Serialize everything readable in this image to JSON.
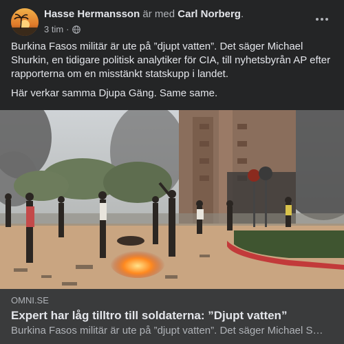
{
  "post": {
    "author": "Hasse Hermansson",
    "with_text": "är med",
    "tagged": "Carl Norberg",
    "tagged_suffix": ".",
    "time": "3 tim",
    "separator": "·",
    "privacy_icon": "globe-icon",
    "more_icon": "more-options-icon",
    "paragraphs": [
      "Burkina Fasos militär är ute på ”djupt vatten”. Det säger Michael Shurkin, en tidigare politisk analytiker för CIA, till nyhetsbyrån AP efter rapporterna om en misstänkt statskupp i landet.",
      "Här verkar samma Djupa Gäng. Same same."
    ]
  },
  "link_preview": {
    "domain": "OMNI.SE",
    "title": "Expert har låg tilltro till soldaterna: ”Djupt vatten”",
    "description": "Burkina Fasos militär är ute på ”djupt vatten”. Det säger Michael Shurkin, en tidigare politisk analytiker för CIA"
  },
  "colors": {
    "background": "#242526",
    "link_box": "#3a3b3c",
    "text_primary": "#e4e6eb",
    "text_secondary": "#b0b3b8"
  }
}
